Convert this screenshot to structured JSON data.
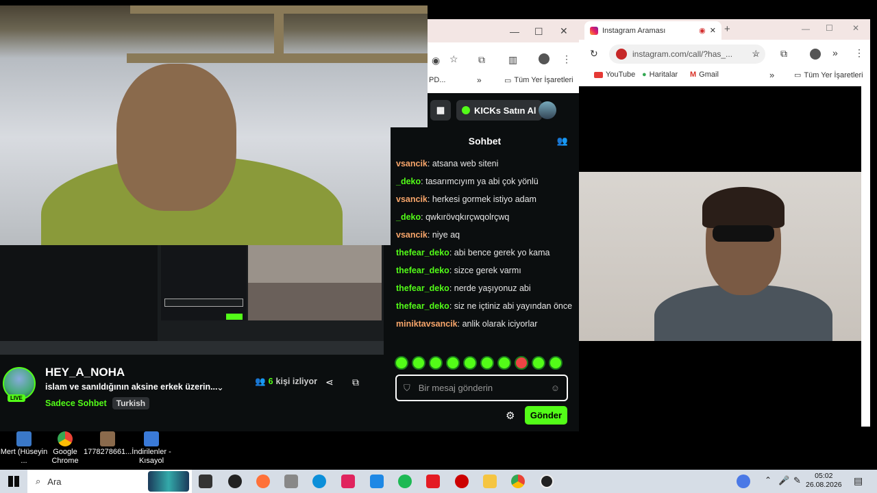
{
  "desktop": {
    "icons": [
      {
        "label": "Mert (Hüseyin ...",
        "color": "#3a78c8"
      },
      {
        "label": "Google Chrome",
        "color": "#e8b23a"
      },
      {
        "label": "1778278661...",
        "color": "#8a6a4c"
      },
      {
        "label": "İndirilenler - Kısayol",
        "color": "#3a7ad8"
      }
    ]
  },
  "chrome_left": {
    "bookmark_left": "PD...",
    "bookmarks_all": "Tüm Yer İşaretleri",
    "kicks_button": "KICKs Satın Al"
  },
  "chat": {
    "title": "Sohbet",
    "messages": [
      {
        "user": "vsancik",
        "text": "atsana web siteni",
        "color": "#f7a56a"
      },
      {
        "user": "_deko",
        "text": "tasarımcıyım ya abi çok yönlü",
        "color": "#53fc18"
      },
      {
        "user": "vsancik",
        "text": "herkesi gormek istiyo adam",
        "color": "#f7a56a"
      },
      {
        "user": "_deko",
        "text": "qwkırövqkırçwqolrçwq",
        "color": "#53fc18"
      },
      {
        "user": "vsancik",
        "text": "niye aq",
        "color": "#f7a56a"
      },
      {
        "user": "thefear_deko",
        "text": "abi bence gerek yo kama",
        "color": "#53fc18"
      },
      {
        "user": "thefear_deko",
        "text": "sizce gerek varmı",
        "color": "#53fc18"
      },
      {
        "user": "thefear_deko",
        "text": "nerde yaşıyonuz abi",
        "color": "#53fc18"
      },
      {
        "user": "thefear_deko",
        "text": "siz ne içtiniz abi yayından önce",
        "color": "#53fc18"
      },
      {
        "user": "miniktavsancik",
        "text": "anlik olarak iciyorlar",
        "color": "#f7a56a"
      }
    ],
    "input_placeholder": "Bir mesaj gönderin",
    "send_label": "Gönder"
  },
  "channel": {
    "name": "HEY_A_NOHA",
    "title": "islam ve sanıldığının aksine erkek üzerin...",
    "category": "Sadece Sohbet",
    "language": "Turkish",
    "live_badge": "LIVE",
    "viewer_count": "6",
    "viewer_suffix": "kişi izliyor"
  },
  "instagram_window": {
    "tab_title": "Instagram Araması",
    "url": "instagram.com/call/?has_...",
    "bookmarks": [
      "YouTube",
      "Haritalar",
      "Gmail"
    ],
    "bookmarks_all": "Tüm Yer İşaretleri"
  },
  "taskbar": {
    "search_placeholder": "Ara",
    "time": "05:02",
    "date": "26.08.2026"
  },
  "colors": {
    "kick_green": "#53fc18",
    "chat_orange": "#f7a56a"
  }
}
